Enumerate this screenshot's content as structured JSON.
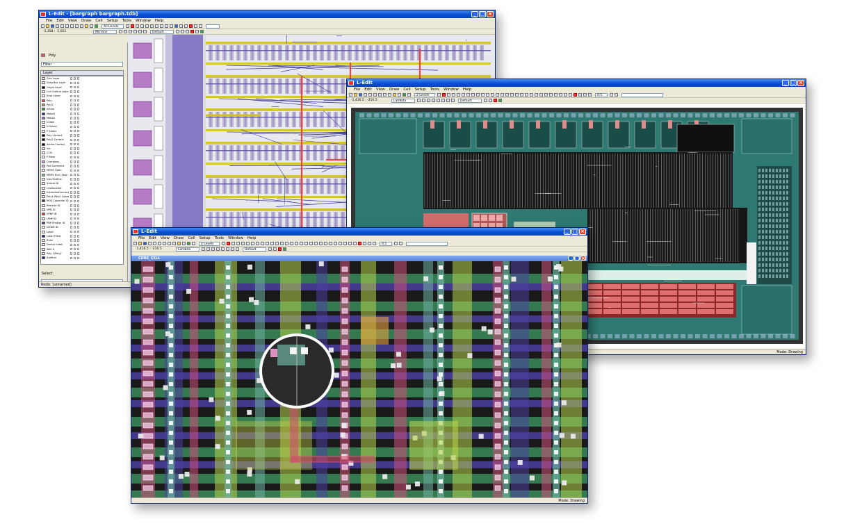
{
  "window1": {
    "title": "L-Edit - [bargraph    bargraph.tdb]",
    "menu": [
      "File",
      "Edit",
      "View",
      "Draw",
      "Cell",
      "Setup",
      "Tools",
      "Window",
      "Help"
    ],
    "levels": "All Levels",
    "units": "Microns",
    "style": "Default",
    "coordinates": "-1,358 : -1,051",
    "active_layer": "Poly",
    "filter": "Filter",
    "layer_header": "Layer",
    "layers": [
      {
        "name": "Grid Layer",
        "color": "#ffffff"
      },
      {
        "name": "Drag Box Layer",
        "color": "#ffffff"
      },
      {
        "name": "Origin Layer",
        "color": "#000000"
      },
      {
        "name": "Cell Outline Layer",
        "color": "#ffffff"
      },
      {
        "name": "Error Layer",
        "color": "#ffffff"
      },
      {
        "name": "Poly",
        "color": "#e8506a"
      },
      {
        "name": "Poly2",
        "color": "#c89a60"
      },
      {
        "name": "Active",
        "color": "#2aa02a"
      },
      {
        "name": "Metal1",
        "color": "#303090"
      },
      {
        "name": "Metal2",
        "color": "#9a70c0"
      },
      {
        "name": "N Well",
        "color": "#ffffff"
      },
      {
        "name": "N Select",
        "color": "#ffffff"
      },
      {
        "name": "P Select",
        "color": "#ffffff"
      },
      {
        "name": "Poly Contact",
        "color": "#000000"
      },
      {
        "name": "Poly2 Contact",
        "color": "#000000"
      },
      {
        "name": "Active Contact",
        "color": "#000000"
      },
      {
        "name": "Via",
        "color": "#ffffff"
      },
      {
        "name": "CCD",
        "color": "#ffffff"
      },
      {
        "name": "P Base",
        "color": "#ffffff"
      },
      {
        "name": "Overglass",
        "color": "#d0a0d0"
      },
      {
        "name": "Pad Comment",
        "color": "#e0c0e0"
      },
      {
        "name": "MEMS Open",
        "color": "#ffffff"
      },
      {
        "name": "MEMS Etch_Stop",
        "color": "#90c090"
      },
      {
        "name": "Icon/Outline",
        "color": "#ffffff"
      },
      {
        "name": "Subckt ID",
        "color": "#ffffff"
      },
      {
        "name": "Unallocated",
        "color": "#ffffff"
      },
      {
        "name": "ExtractedConnect",
        "color": "#ffffff"
      },
      {
        "name": "Poly1-Poly2 Capacitor",
        "color": "#ffffff"
      },
      {
        "name": "MOS Capacitor ID",
        "color": "#404040"
      },
      {
        "name": "Resistor ID",
        "color": "#ffffff"
      },
      {
        "name": "NPN ID",
        "color": "#ffffff"
      },
      {
        "name": "VPNP ID",
        "color": "#e04040"
      },
      {
        "name": "LPNP ID",
        "color": "#ffffff"
      },
      {
        "name": "PNP Emitter ID",
        "color": "#404060"
      },
      {
        "name": "DIODE ID",
        "color": "#ffffff"
      },
      {
        "name": "Label",
        "color": "#ffffff"
      },
      {
        "name": "Label Filled",
        "color": "#202080"
      },
      {
        "name": "Ruler",
        "color": "#ffffff"
      },
      {
        "name": "Device Label",
        "color": "#ffffff"
      },
      {
        "name": "Well X",
        "color": "#ffffff"
      },
      {
        "name": "Poly 1/Poly2",
        "color": "#ffffff"
      },
      {
        "name": "Subfirst",
        "color": "#202080"
      }
    ],
    "select_label": "Select:",
    "status": "Node: (unnamed)"
  },
  "window2": {
    "title": "L-Edit",
    "menu": [
      "File",
      "Edit",
      "View",
      "Draw",
      "Cell",
      "Setup",
      "Tools",
      "Window",
      "Help"
    ],
    "levels": "2 Levels",
    "units": "Lambda",
    "style": "Default",
    "coordinates": "-1,416.5 : -216.5",
    "zoom": "0.5",
    "status": "Mode: Drawing"
  },
  "window3": {
    "title": "L-Edit",
    "menu": [
      "File",
      "Edit",
      "View",
      "Draw",
      "Cell",
      "Setup",
      "Tools",
      "Window",
      "Help"
    ],
    "levels": "2 Levels",
    "units": "Lambda",
    "style": "Default",
    "coordinates": "-1,416.5 : -216.5",
    "zoom": "0.5",
    "cell_name": "CORE_CELL",
    "status": "Mode: Drawing"
  },
  "colors": {
    "titlebar": "#0a4fd6",
    "chrome": "#ece9d8",
    "die_bg": "#2e7a72",
    "layout_bg": "#1a1a1a",
    "metal": "#4b3fa0",
    "poly": "#d0507a",
    "active": "#7ac23a"
  }
}
